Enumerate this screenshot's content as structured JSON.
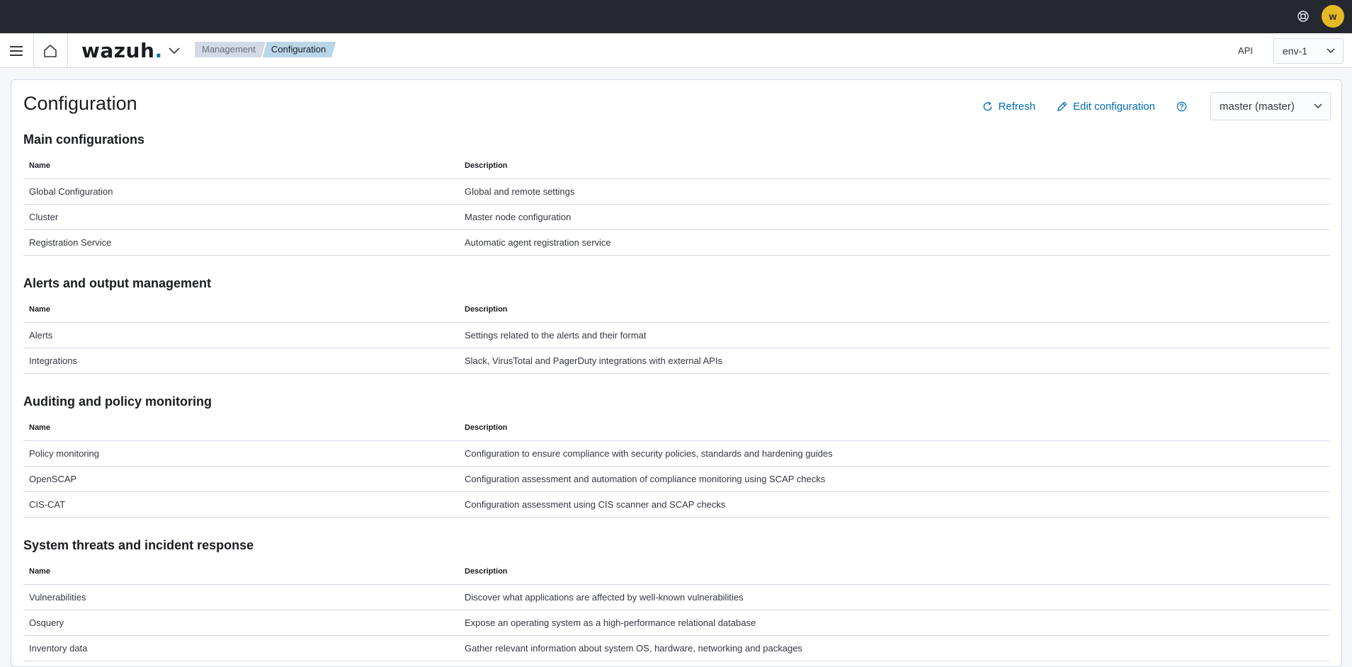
{
  "topbar": {
    "avatar_initial": "w"
  },
  "header": {
    "logo_text": "wazuh",
    "logo_dot": ".",
    "breadcrumb": [
      "Management",
      "Configuration"
    ],
    "api_label": "API",
    "env_value": "env-1"
  },
  "page": {
    "title": "Configuration",
    "refresh_label": "Refresh",
    "edit_label": "Edit configuration",
    "node_value": "master (master)"
  },
  "colors": {
    "topbar": "#25282f",
    "link": "#006bb8",
    "avatar": "#e7b926",
    "crumb_active": "#b9d5e8"
  },
  "table_headers": {
    "name": "Name",
    "description": "Description"
  },
  "sections": [
    {
      "title": "Main configurations",
      "rows": [
        {
          "name": "Global Configuration",
          "description": "Global and remote settings"
        },
        {
          "name": "Cluster",
          "description": "Master node configuration"
        },
        {
          "name": "Registration Service",
          "description": "Automatic agent registration service"
        }
      ]
    },
    {
      "title": "Alerts and output management",
      "rows": [
        {
          "name": "Alerts",
          "description": "Settings related to the alerts and their format"
        },
        {
          "name": "Integrations",
          "description": "Slack, VirusTotal and PagerDuty integrations with external APIs"
        }
      ]
    },
    {
      "title": "Auditing and policy monitoring",
      "rows": [
        {
          "name": "Policy monitoring",
          "description": "Configuration to ensure compliance with security policies, standards and hardening guides"
        },
        {
          "name": "OpenSCAP",
          "description": "Configuration assessment and automation of compliance monitoring using SCAP checks"
        },
        {
          "name": "CIS-CAT",
          "description": "Configuration assessment using CIS scanner and SCAP checks"
        }
      ]
    },
    {
      "title": "System threats and incident response",
      "rows": [
        {
          "name": "Vulnerabilities",
          "description": "Discover what applications are affected by well-known vulnerabilities"
        },
        {
          "name": "Osquery",
          "description": "Expose an operating system as a high-performance relational database"
        },
        {
          "name": "Inventory data",
          "description": "Gather relevant information about system OS, hardware, networking and packages"
        }
      ]
    }
  ]
}
